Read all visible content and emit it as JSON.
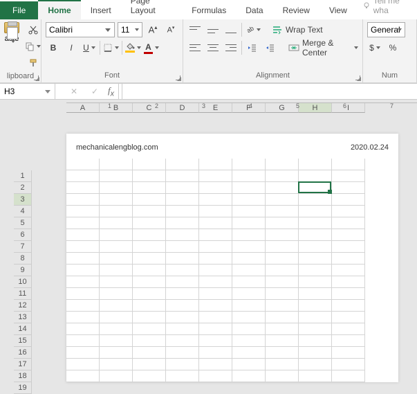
{
  "tabs": {
    "file": "File",
    "home": "Home",
    "insert": "Insert",
    "page_layout": "Page Layout",
    "formulas": "Formulas",
    "data": "Data",
    "review": "Review",
    "view": "View",
    "tell_me": "Tell me wha"
  },
  "ribbon": {
    "clipboard": {
      "paste": "aste",
      "label": "lipboard"
    },
    "font": {
      "family": "Calibri",
      "size": "11",
      "label": "Font"
    },
    "alignment": {
      "wrap": "Wrap Text",
      "merge": "Merge & Center",
      "label": "Alignment"
    },
    "number": {
      "format": "General",
      "label": "Num"
    }
  },
  "namebox": "H3",
  "ruler_ticks": [
    "1",
    "2",
    "3",
    "4",
    "5",
    "6",
    "7"
  ],
  "columns": [
    "A",
    "B",
    "C",
    "D",
    "E",
    "F",
    "G",
    "H",
    "I"
  ],
  "rows": [
    "1",
    "2",
    "3",
    "4",
    "5",
    "6",
    "7",
    "8",
    "9",
    "10",
    "11",
    "12",
    "13",
    "14",
    "15",
    "16",
    "17",
    "18",
    "19"
  ],
  "selected_row": "3",
  "selected_col": "H",
  "page": {
    "left_header": "mechanicalengblog.com",
    "right_header": "2020.02.24"
  },
  "chart_data": null
}
